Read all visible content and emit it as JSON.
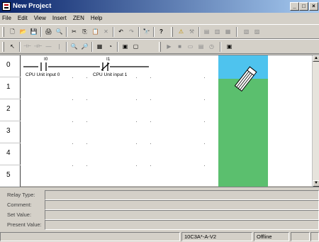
{
  "window": {
    "title": "New Project"
  },
  "menu": [
    "File",
    "Edit",
    "View",
    "Insert",
    "ZEN",
    "Help"
  ],
  "toolbar1": [
    {
      "glyph": "🗋",
      "name": "new-icon"
    },
    {
      "glyph": "📂",
      "name": "open-icon"
    },
    {
      "glyph": "💾",
      "name": "save-icon"
    },
    {
      "glyph": "🖨",
      "name": "print-icon"
    },
    {
      "glyph": "🔍",
      "name": "print-preview-icon"
    },
    {
      "glyph": "✂",
      "name": "cut-icon"
    },
    {
      "glyph": "⎘",
      "name": "copy-icon"
    },
    {
      "glyph": "📋",
      "name": "paste-icon"
    },
    {
      "glyph": "✕",
      "name": "delete-icon"
    },
    {
      "glyph": "↶",
      "name": "undo-icon"
    },
    {
      "glyph": "↷",
      "name": "redo-icon"
    },
    {
      "glyph": "🔭",
      "name": "find-icon"
    },
    {
      "glyph": "?",
      "name": "help-icon"
    },
    {
      "glyph": "⚠",
      "name": "program-check-icon"
    },
    {
      "glyph": "⚒",
      "name": "simulation-icon"
    },
    {
      "glyph": "▤",
      "name": "transfer-to-icon"
    },
    {
      "glyph": "▥",
      "name": "transfer-from-icon"
    },
    {
      "glyph": "▦",
      "name": "compare-icon"
    },
    {
      "glyph": "▧",
      "name": "monitor-icon"
    },
    {
      "glyph": "▨",
      "name": "online-edit-icon"
    }
  ],
  "toolbar2": [
    {
      "glyph": "↖",
      "name": "select-tool-icon"
    },
    {
      "glyph": "⊣⊢",
      "name": "no-contact-tool-icon"
    },
    {
      "glyph": "⊣/⊢",
      "name": "nc-contact-tool-icon"
    },
    {
      "glyph": "—",
      "name": "horizontal-line-tool-icon"
    },
    {
      "glyph": "|",
      "name": "vertical-line-tool-icon"
    },
    {
      "glyph": "🔍",
      "name": "zoom-in-icon"
    },
    {
      "glyph": "🔎",
      "name": "zoom-out-icon"
    },
    {
      "glyph": "▦",
      "name": "grid-icon"
    },
    {
      "glyph": "◔",
      "name": "comment-icon"
    },
    {
      "glyph": "▣",
      "name": "io-comment-icon"
    },
    {
      "glyph": "▢",
      "name": "monitor-values-icon"
    },
    {
      "glyph": "▶",
      "name": "run-icon"
    },
    {
      "glyph": "■",
      "name": "stop-icon"
    },
    {
      "glyph": "▭",
      "name": "program-mode-icon"
    },
    {
      "glyph": "▤",
      "name": "monitor-mode-icon"
    },
    {
      "glyph": "◷",
      "name": "timer-icon"
    },
    {
      "glyph": "▣",
      "name": "memory-icon"
    }
  ],
  "ladder": {
    "rung_numbers": [
      "0",
      "1",
      "2",
      "3",
      "4",
      "5"
    ],
    "contacts": [
      {
        "address": "I0",
        "comment": "CPU Unit input 0",
        "type": "NO"
      },
      {
        "address": "I1",
        "comment": "CPU Unit input 1",
        "type": "NC"
      }
    ],
    "colors": {
      "drop_zone_top": "#4ec3ee",
      "drop_zone_bottom": "#5bbf6e",
      "background": "#ffffff"
    }
  },
  "properties": {
    "relay_type_label": "Relay Type:",
    "comment_label": "Comment:",
    "set_value_label": "Set Value:",
    "present_value_label": "Present Value:",
    "relay_type_value": "",
    "comment_value": "",
    "set_value_value": "",
    "present_value_value": ""
  },
  "status": {
    "model": "10C3A*-A-V2",
    "connection": "Offline"
  }
}
